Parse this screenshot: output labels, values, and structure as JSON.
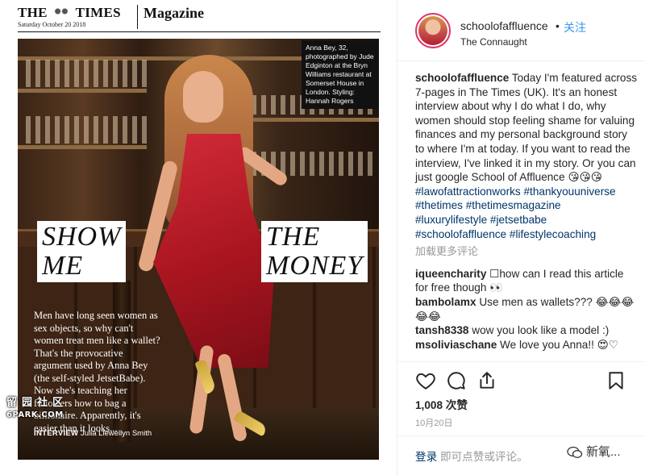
{
  "magazine": {
    "masthead_left": "THE",
    "masthead_right": "TIMES",
    "date": "Saturday October 20 2018",
    "section": "Magazine",
    "photo_caption": "Anna Bey, 32, photographed by Jude Edginton at the Bryn Williams restaurant at Somerset House in London. Styling: Hannah Rogers",
    "headline_left": [
      "SHOW",
      "ME"
    ],
    "headline_right": [
      "THE",
      "MONEY"
    ],
    "intro": "Men have long seen women as sex objects, so why can't women treat men like a wallet? That's the provocative argument used by Anna Bey (the self-styled JetsetBabe). Now she's teaching her followers how to bag a billionaire. Apparently, it's easier than it looks...",
    "byline_label": "INTERVIEW",
    "byline_name": "Julia Llewellyn Smith"
  },
  "watermark": {
    "line1": "留园社区",
    "line2": "6PARK.COM"
  },
  "post_header": {
    "username": "schoolofaffluence",
    "separator": "•",
    "follow_label": "关注",
    "location": "The Connaught"
  },
  "caption": {
    "username": "schoolofaffluence",
    "text": " Today I'm featured across 7-pages in The Times (UK). It's an honest interview about why I do what I do, why women should stop feeling shame for valuing finances and my personal background story to where I'm at today. If you want to read the interview, I've linked it in my story. Or you can just google School of Affluence 😘😘😘",
    "hashtags_line1": "#lawofattractionworks #thankyouuniverse",
    "hashtags_line2": "#thetimes #thetimesmagazine",
    "hashtags_line3": "#luxurylifestyle #jetsetbabe",
    "hashtags_line4": "#schoolofaffluence #lifestylecoaching"
  },
  "load_more_label": "加载更多评论",
  "comments": [
    {
      "user": "iqueencharity",
      "text": " ☐how can I read this article for free though 👀"
    },
    {
      "user": "bambolamx",
      "text": " Use men as wallets??? 😂😂😂😂😂"
    },
    {
      "user": "tansh8338",
      "text": " wow you look like a model :)"
    },
    {
      "user": "msoliviaschane",
      "text": " We love you Anna!! 😍♡"
    }
  ],
  "actions": {
    "like_icon": "heart-icon",
    "comment_icon": "comment-icon",
    "share_icon": "share-icon",
    "save_icon": "bookmark-icon"
  },
  "likes": "1,008 次赞",
  "post_date": "10月20日",
  "login_prompt": {
    "link": "登录",
    "text": " 即可点赞或评论。"
  },
  "wechat_watermark": "新氧..."
}
